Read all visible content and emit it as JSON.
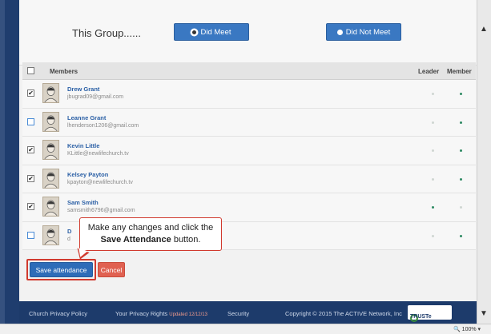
{
  "group": {
    "label": "This Group......",
    "did_meet": "Did Meet",
    "did_not_meet": "Did Not Meet",
    "selected": "did_meet"
  },
  "table": {
    "headers": {
      "members": "Members",
      "leader": "Leader",
      "member": "Member"
    },
    "rows": [
      {
        "name": "Drew Grant",
        "email": "jbugrad09@gmail.com",
        "checked": true,
        "leader": false,
        "member": true
      },
      {
        "name": "Leanne Grant",
        "email": "lhenderson1206@gmail.com",
        "checked": false,
        "leader": false,
        "member": true
      },
      {
        "name": "Kevin Little",
        "email": "KLittle@newlifechurch.tv",
        "checked": true,
        "leader": false,
        "member": true
      },
      {
        "name": "Kelsey Payton",
        "email": "kpayton@newlifechurch.tv",
        "checked": true,
        "leader": false,
        "member": true
      },
      {
        "name": "Sam Smith",
        "email": "samsmith6796@gmail.com",
        "checked": true,
        "leader": true,
        "member": false
      },
      {
        "name": "D",
        "email": "d",
        "checked": false,
        "leader": false,
        "member": true
      }
    ]
  },
  "actions": {
    "save": "Save attendance",
    "cancel": "Cancel"
  },
  "callout": {
    "line1": "Make any changes and click the",
    "bold": "Save Attendance",
    "line2_tail": " button."
  },
  "footer": {
    "privacy_policy": "Church Privacy Policy",
    "privacy_rights": "Your Privacy Rights",
    "privacy_updated": "Updated 12/12/13",
    "security": "Security",
    "copyright": "Copyright © 2015 The ACTIVE Network, Inc",
    "truste": "TRUSTe"
  },
  "statusbar": {
    "zoom": "100%"
  },
  "colors": {
    "accent": "#3a78c2",
    "cancel": "#e06151",
    "highlight": "#d13a2e",
    "footer": "#1d3b6b"
  }
}
